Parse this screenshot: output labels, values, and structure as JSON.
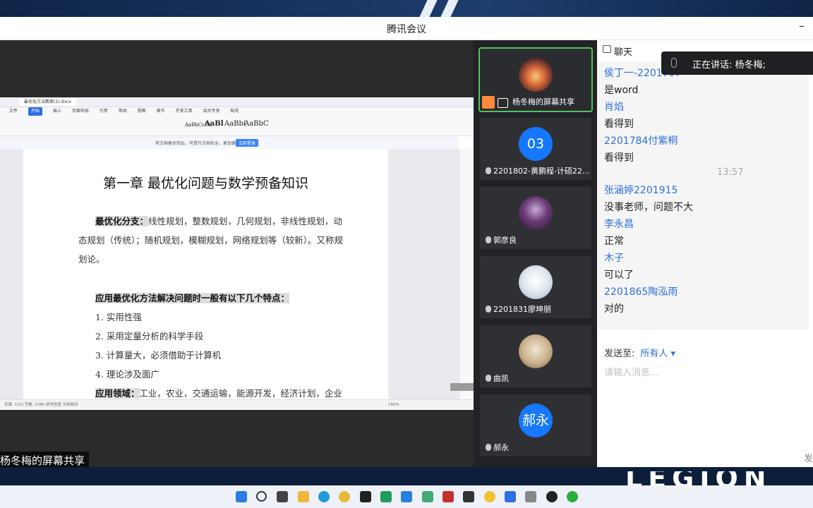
{
  "window": {
    "title": "腾讯会议"
  },
  "share": {
    "label": "杨冬梅的屏幕共享",
    "doc_tab": "最优化方法教案(1).docx",
    "menu": [
      "文件",
      "开始",
      "插入",
      "页面布局",
      "引用",
      "审阅",
      "视图",
      "章节",
      "开发工具",
      "会员专享",
      "稻壳"
    ],
    "styles": [
      "AaBbCcDd",
      "AaBl",
      "AaBb(",
      "AaBbC"
    ],
    "notice": "将文档备份到云，可提升文档安全，更加便捷",
    "notice_btn": "立即登录",
    "status": "页面: 1/10   字数: 2785   拼写检查   文档校对",
    "zoom": "150%",
    "doc": {
      "heading": "第一章  最优化问题与数学预备知识",
      "p1_bold": "最优化分支：",
      "p1_line1": "线性规划，整数规划，几何规划，非线性规划，动",
      "p1_line2": "态规划（传统）；随机规划，模糊规划，网络规划等（较新）。又称规",
      "p1_line3": "划论。",
      "p2": "应用最优化方法解决问题时一般有以下几个特点：",
      "items": [
        "1. 实用性强",
        "2. 采用定量分析的科学手段",
        "3. 计算量大，必须借助于计算机",
        "4. 理论涉及面广"
      ],
      "p3_bold": "应用领域：",
      "p3_text": "工业，农业，交通运输，能源开发，经济计划，企业"
    }
  },
  "participants": [
    {
      "label": "杨冬梅的屏幕共享",
      "avatar": "sunset-photo"
    },
    {
      "label": "2201802-黄鹏程-计硕22...",
      "avatar_text": "03"
    },
    {
      "label": "郭彦良",
      "avatar": "anime-photo"
    },
    {
      "label": "2201831廖坤朋",
      "avatar": "cartoon-photo"
    },
    {
      "label": "曲凯",
      "avatar": "dog-photo"
    },
    {
      "label": "郝永",
      "avatar_text": "郝永"
    }
  ],
  "chat": {
    "title": "聊天",
    "speaking": "正在讲话: 杨冬梅;",
    "messages": [
      {
        "name": "侯丁一-2201797",
        "text": "是word"
      },
      {
        "name": "肖焰",
        "text": "看得到"
      },
      {
        "name": "2201784付紫桐",
        "text": "看得到"
      },
      {
        "time": "13:57"
      },
      {
        "name": "张涵婷2201915",
        "text": "没事老师，问题不大"
      },
      {
        "name": "李永昌",
        "text": "正常"
      },
      {
        "name": "木子",
        "text": "可以了"
      },
      {
        "name": "2201865陶泓雨",
        "text": "对的"
      }
    ],
    "send_to_label": "发送至:",
    "send_to_value": "所有人 ▾",
    "input_placeholder": "请输入消息...",
    "send_button": "发"
  },
  "desktop": {
    "brand": "LEGION"
  }
}
